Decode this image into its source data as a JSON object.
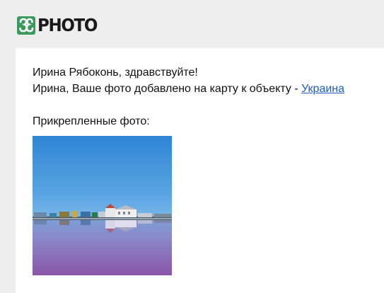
{
  "header": {
    "logo_text": "PHOTO",
    "logo_color": "#3a9a5c"
  },
  "message": {
    "greeting": "Ирина Рябоконь, здравствуйте!",
    "notice_prefix": "Ирина, Ваше фото добавлено на карту к объекту - ",
    "location_link": "Украина",
    "link_color": "#1f5fc9",
    "attached_label": "Прикрепленные фото:"
  },
  "photo": {
    "subject": "salt-lake-landscape"
  }
}
